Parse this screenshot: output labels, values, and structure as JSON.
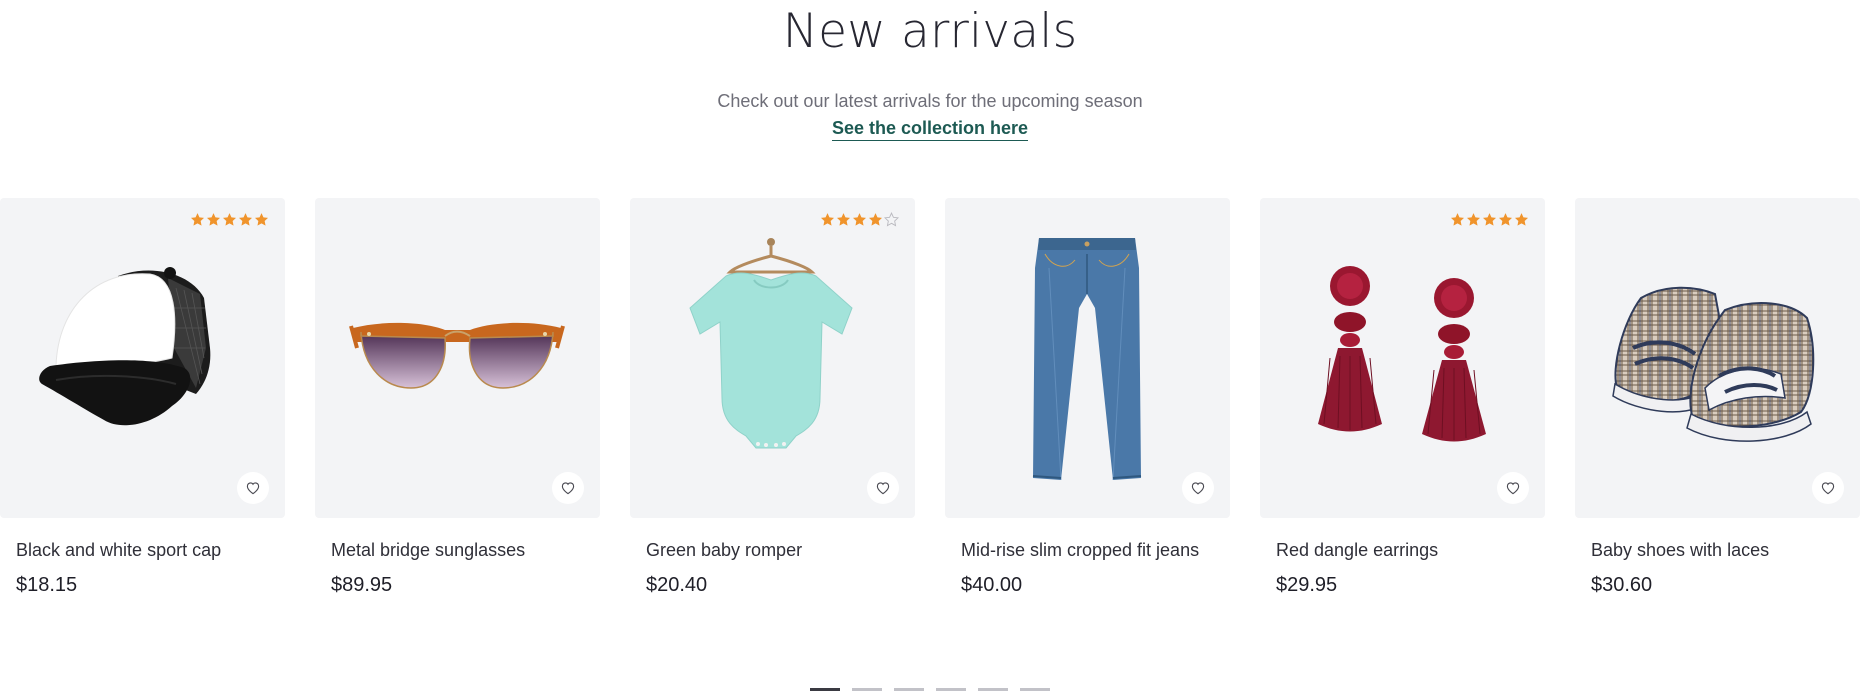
{
  "header": {
    "title": "New arrivals",
    "subtitle": "Check out our latest arrivals for the upcoming season",
    "link_label": "See the collection here"
  },
  "colors": {
    "star": "#f0942c",
    "star_empty": "#b9b9bf",
    "link": "#1d5a53",
    "card_bg": "#f3f4f6"
  },
  "products": [
    {
      "name": "Black and white sport cap",
      "price": "$18.15",
      "rating": 5,
      "image": "cap-image",
      "favorite_icon": "heart-icon"
    },
    {
      "name": "Metal bridge sunglasses",
      "price": "$89.95",
      "rating": 0,
      "image": "sunglasses-image",
      "favorite_icon": "heart-icon"
    },
    {
      "name": "Green baby romper",
      "price": "$20.40",
      "rating": 4,
      "image": "romper-image",
      "favorite_icon": "heart-icon"
    },
    {
      "name": "Mid-rise slim cropped fit jeans",
      "price": "$40.00",
      "rating": 0,
      "image": "jeans-image",
      "favorite_icon": "heart-icon"
    },
    {
      "name": "Red dangle earrings",
      "price": "$29.95",
      "rating": 5,
      "image": "earrings-image",
      "favorite_icon": "heart-icon"
    },
    {
      "name": "Baby shoes with laces",
      "price": "$30.60",
      "rating": 0,
      "image": "baby-shoes-image",
      "favorite_icon": "heart-icon"
    }
  ],
  "pagination": {
    "pages": 6,
    "active": 1
  }
}
